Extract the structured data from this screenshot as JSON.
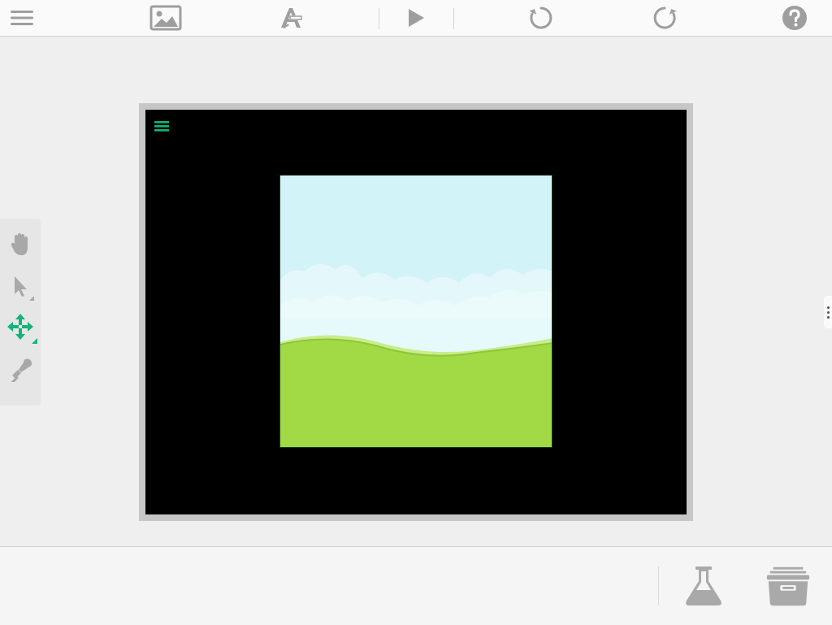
{
  "colors": {
    "toolbar_icon": "#9e9e9e",
    "accent_green": "#11b57a",
    "stage_background": "#000000",
    "sky": "#d2f3f7",
    "grass": "#a2da46"
  },
  "toolbar": {
    "items": [
      "menu-icon",
      "background-image-icon",
      "text-style-icon",
      "play-icon",
      "undo-icon",
      "redo-icon",
      "help-icon"
    ]
  },
  "left_tools": {
    "items": [
      "hand-icon",
      "select-arrow-icon",
      "move-arrows-icon",
      "stamp-icon"
    ],
    "active": "move-arrows-icon"
  },
  "bottom": {
    "items": [
      "flask-icon",
      "archive-box-icon"
    ]
  }
}
